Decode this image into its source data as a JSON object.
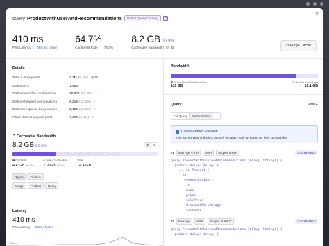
{
  "header": {
    "query_prefix": "query",
    "query_name": "ProductWithUserAndRecommendations",
    "badge": "Partial Query Caching",
    "purge_label": "Purge Cache"
  },
  "metrics": [
    {
      "value": "410 ms",
      "delta": "",
      "label": "P95 Latency",
      "extra": "388 ms faster",
      "extra_icon": "arrow-down-icon"
    },
    {
      "value": "64.7%",
      "delta": "",
      "label": "Cache Hit Rate",
      "extra": "78.2%",
      "extra_icon": "gauge-icon"
    },
    {
      "value": "8.2 GB",
      "delta": "56.9%",
      "label": "Cacheable Bandwidth",
      "extra": "$8",
      "extra_icon": "dollar-icon"
    }
  ],
  "details": {
    "title": "Details",
    "rows": [
      {
        "label": "Total # of requests",
        "num": "7.2M",
        "pct": "(8.4%)",
        "ext": "4h"
      },
      {
        "label": "Distinct IPs",
        "num": "1,456",
        "pct": "",
        "ext": ""
      },
      {
        "label": "Distinct variable combinations",
        "num": "28,675",
        "pct": "(33.8%)",
        "ext": "↑"
      },
      {
        "label": "Distinct headers combinations",
        "num": "4,219",
        "pct": "(12.3%)",
        "ext": "↑"
      },
      {
        "label": "Distinct response body values",
        "num": "3,456",
        "pct": "(12.3%)",
        "ext": "↑"
      },
      {
        "label": "Other distinct request parts",
        "num": "1,406",
        "pct": "(8.4%)",
        "ext": "↑"
      }
    ]
  },
  "cacheable_bandwidth": {
    "title": "Cacheable Bandwidth",
    "value": "8.2 GB",
    "pct": "56.9%",
    "toggle": [
      "$",
      "%"
    ],
    "bar_cached_fraction": 0.3,
    "bar_noncached_fraction": 0.43,
    "legend": [
      {
        "label": "Cached",
        "value": "4.4 GB",
        "sub": "30.6%",
        "color": "#6f52d9"
      },
      {
        "label": "Non-Cacheable",
        "value": "1.9 GB",
        "sub": "13.2%",
        "color": "#c9bff3"
      },
      {
        "label": "Total",
        "value": "14.4 GB",
        "sub": "",
        "color": ""
      }
    ],
    "filters": [
      "Types",
      "Fields"
    ],
    "filter_count": "8",
    "types": [
      "Image",
      "Product",
      "Query"
    ]
  },
  "latency": {
    "title": "Latency",
    "value": "410 ms",
    "label": "P95 Latency",
    "extra": "388ms faster",
    "axis_label": "600ms"
  },
  "bandwidth": {
    "title": "Bandwidth",
    "served_cache_label": "Served from Stellate cache",
    "served_cache_value": "110 GB",
    "served_origin_label": "Served from origin",
    "served_origin_value": "10.1 GB",
    "cache_fraction": 0.85,
    "colors": {
      "cache": "#7055d9",
      "origin": "#e8e4fa"
    }
  },
  "query_panel": {
    "title": "Query",
    "run_label": "Run",
    "tabs": [
      "Full Query",
      "Cache Entries"
    ],
    "active_tab": "Cache Entries",
    "info_title": "Cache Entries Preview",
    "info_desc": "This is a preview of distinct parts of the query split up based on their cacheability.",
    "entries": [
      {
        "num": "#1",
        "tags": [
          "Max Age",
          "5 min",
          "SWR",
          "Scopes",
          "USER"
        ],
        "status": "CACHEABLE",
        "code": [
          "query ProductWithUserAndRecommendations ($slug: String!) {",
          "  product($slug: $slug) {",
          "    ... on Product {",
          "      id",
          "      recommendations {",
          "        id",
          "        name",
          "        price",
          "        salePrice",
          "        discountPercentage",
          "        category"
        ]
      },
      {
        "num": "#2",
        "tags": [
          "Max Age",
          "SWR",
          "Scopes",
          "PUBLIC"
        ],
        "status": "CACHEABLE",
        "code": [
          "query ProductWithUserAndRecommendations ($slug: String!) {",
          "  product($slug: $slug) {"
        ]
      }
    ]
  }
}
